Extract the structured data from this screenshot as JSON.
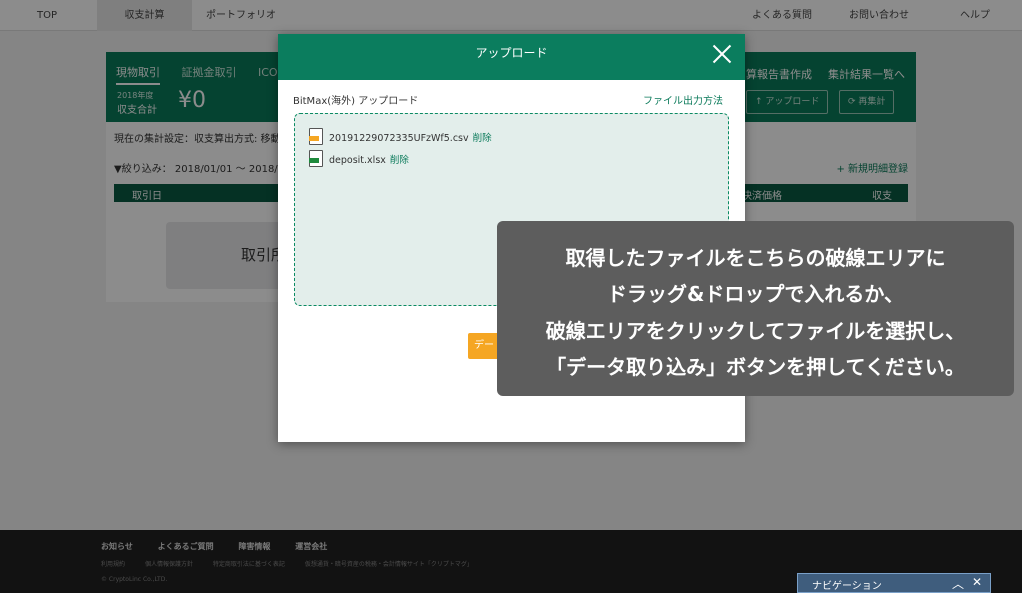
{
  "topnav": {
    "top": "TOP",
    "income": "収支計算",
    "portfolio": "ポートフォリオ",
    "faq": "よくある質問",
    "contact": "お問い合わせ",
    "help": "ヘルプ"
  },
  "card": {
    "tabs": [
      "現物取引",
      "証拠金取引",
      "ICO"
    ],
    "report": "算報告書作成",
    "summary": "集計結果一覧へ",
    "year": "2018年度",
    "total_label": "収支合計",
    "total_value": "¥0",
    "upload_btn": "アップロード",
    "recalc_btn": "再集計",
    "setting": "現在の集計設定：収支算出方式: 移動平",
    "filter": "▼絞り込み： 2018/01/01 〜 2018/12/",
    "new_entry": "+ 新規明細登録",
    "col_date": "取引日",
    "col_price": "決済価格",
    "col_income": "収支",
    "empty_text": "取引所"
  },
  "modal": {
    "title": "アップロード",
    "source": "BitMax(海外) アップロード",
    "howto": "ファイル出力方法",
    "files": [
      {
        "name": "20191229072335UFzWf5.csv",
        "delete": "削除"
      },
      {
        "name": "deposit.xlsx",
        "delete": "削除"
      }
    ],
    "import_btn": "デー"
  },
  "callout": {
    "lines": [
      "取得したファイルをこちらの破線エリアに",
      "ドラッグ&ドロップで入れるか、",
      "破線エリアをクリックしてファイルを選択し、",
      "「データ取り込み」ボタンを押してください。"
    ]
  },
  "footer": {
    "links": [
      "お知らせ",
      "よくあるご質問",
      "障害情報",
      "運営会社"
    ],
    "sublinks": [
      "利用規約",
      "個人情報保護方針",
      "特定商取引法に基づく表記",
      "仮想通貨・暗号資産の税務・会計情報サイト「クリプトマグ」"
    ],
    "copyright": "© CryptoLinc Co.,LTD."
  },
  "navbar": {
    "label": "ナビゲーション"
  },
  "colors": {
    "brand_green": "#0a7a5a",
    "accent_orange": "#f5a623",
    "callout_bg": "#5d5d5d",
    "csv_tag": "#f5a623",
    "xlsx_tag": "#1e8a3c"
  },
  "icons": [
    "close-icon",
    "upload-icon",
    "refresh-icon",
    "csv-file-icon",
    "xlsx-file-icon",
    "chevron-up-icon",
    "close-icon"
  ]
}
